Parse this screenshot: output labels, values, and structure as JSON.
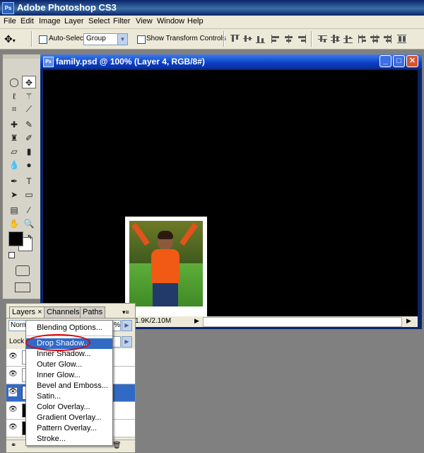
{
  "app": {
    "title": "Adobe Photoshop CS3",
    "icon": "ps-icon"
  },
  "menu": [
    "File",
    "Edit",
    "Image",
    "Layer",
    "Select",
    "Filter",
    "View",
    "Window",
    "Help"
  ],
  "options": {
    "auto_select_label": "Auto-Select:",
    "auto_select_value": "Group",
    "show_transform_label": "Show Transform Controls"
  },
  "document": {
    "title": "family.psd @ 100% (Layer 4, RGB/8#)",
    "status_size": "1.9K/2.10M",
    "status_zoom": "%"
  },
  "layers_panel": {
    "tabs": [
      "Layers",
      "Channels",
      "Paths"
    ],
    "blend_mode": "Norm",
    "opacity": "%",
    "lock_label": "Lock"
  },
  "context_menu": {
    "items": [
      "Blending Options...",
      "Drop Shadow...",
      "Inner Shadow...",
      "Outer Glow...",
      "Inner Glow...",
      "Bevel and Emboss...",
      "Satin...",
      "Color Overlay...",
      "Gradient Overlay...",
      "Pattern Overlay...",
      "Stroke..."
    ],
    "highlighted": "Drop Shadow...",
    "highlight_color": "#316ac5",
    "annotation_color": "#e00000"
  },
  "colors": {
    "foreground": "#000000",
    "background": "#ffffff",
    "canvas": "#000000"
  }
}
